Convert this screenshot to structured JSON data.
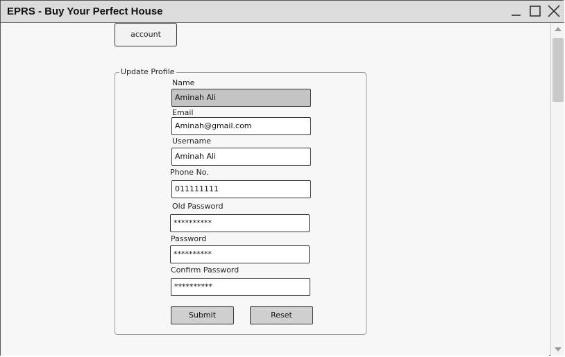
{
  "window": {
    "title": "EPRS - Buy Your Perfect House"
  },
  "nav": {
    "account_tab": "account"
  },
  "form": {
    "legend": "Update Profile",
    "fields": {
      "name": {
        "label": "Name",
        "value": "Aminah Ali",
        "disabled": true
      },
      "email": {
        "label": "Email",
        "value": "Aminah@gmail.com"
      },
      "username": {
        "label": "Username",
        "value": "Aminah Ali"
      },
      "phone": {
        "label": "Phone No.",
        "value": "011111111"
      },
      "old_password": {
        "label": "Old Password",
        "value": "**********"
      },
      "password": {
        "label": "Password",
        "value": "**********"
      },
      "confirm_password": {
        "label": "Confirm Password",
        "value": "**********"
      }
    },
    "buttons": {
      "submit": "Submit",
      "reset": "Reset"
    }
  },
  "colors": {
    "titlebar": "#dcdcdc",
    "disabled_field": "#c4c4c4",
    "button": "#cfcfcf"
  },
  "icons": [
    "minimize-icon",
    "maximize-icon",
    "close-icon",
    "scroll-up-icon",
    "scroll-down-icon"
  ]
}
